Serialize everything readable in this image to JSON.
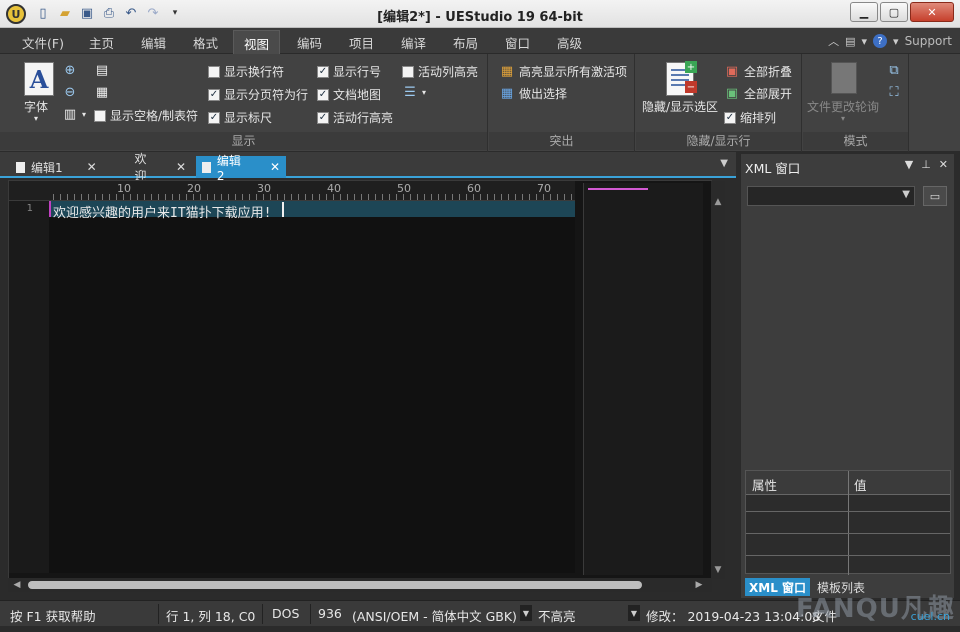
{
  "window": {
    "title": "[编辑2*] - UEStudio 19 64-bit"
  },
  "menu": {
    "tabs": [
      "文件(F)",
      "主页",
      "编辑",
      "格式",
      "视图",
      "编码",
      "项目",
      "编译",
      "布局",
      "窗口",
      "高级"
    ],
    "active_tab": "视图",
    "support_label": "Support"
  },
  "ribbon": {
    "display_group": {
      "label": "显示",
      "font_label": "字体",
      "show_whitespace": "显示空格/制表符",
      "show_linebreaks": "显示换行符",
      "show_pagebreaks": "显示分页符为行",
      "show_ruler": "显示标尺",
      "show_linenumbers": "显示行号",
      "docmap": "文档地图",
      "active_line_highlight": "活动行高亮",
      "active_column_highlight": "活动列高亮"
    },
    "highlight_group": {
      "label": "突出",
      "highlight_all": "高亮显示所有激活项",
      "make_selection": "做出选择"
    },
    "hide_group": {
      "label": "隐藏/显示行",
      "hide_show_selection": "隐藏/显示选区",
      "fold_all": "全部折叠",
      "expand_all": "全部展开",
      "indent_column": "缩排列"
    },
    "mode_group": {
      "label": "模式",
      "file_change_poll": "文件更改轮询"
    }
  },
  "doc_tabs": [
    {
      "label": "编辑1",
      "active": false
    },
    {
      "label": "欢迎",
      "active": false
    },
    {
      "label": "编辑2",
      "active": true
    }
  ],
  "ruler": {
    "numbers": [
      "10",
      "20",
      "30",
      "40",
      "50",
      "60",
      "70"
    ]
  },
  "editor": {
    "line_number": "1",
    "line_text": "欢迎感兴趣的用户来IT猫扑下载应用!"
  },
  "xml_panel": {
    "title": "XML 窗口",
    "prop_header": "属性",
    "value_header": "值",
    "tabs": [
      "XML 窗口",
      "模板列表"
    ]
  },
  "status": {
    "help": "按 F1 获取帮助",
    "position": "行 1, 列 18, C0",
    "line_ending": "DOS",
    "codepage": "936",
    "encoding": "(ANSI/OEM - 简体中文 GBK)",
    "highlight": "不高亮",
    "modified": "修改： 2019-04-23 13:04:08",
    "file_size": "文件"
  },
  "watermark": {
    "brand": "FANQU凡趣",
    "domain": "cuel.cn"
  },
  "colors": {
    "accent": "#2a8fc9",
    "active_line": "#1d4656"
  }
}
